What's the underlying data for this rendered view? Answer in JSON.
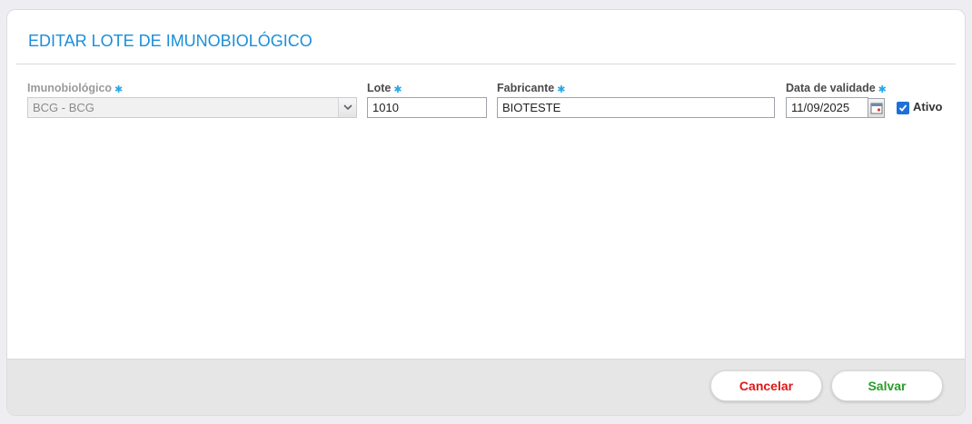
{
  "modal": {
    "title": "EDITAR LOTE DE IMUNOBIOLÓGICO"
  },
  "form": {
    "required_marker": "✱",
    "imunobiologico": {
      "label": "Imunobiológico",
      "value": "BCG - BCG",
      "disabled": true
    },
    "lote": {
      "label": "Lote",
      "value": "1010"
    },
    "fabricante": {
      "label": "Fabricante",
      "value": "BIOTESTE"
    },
    "data_validade": {
      "label": "Data de validade",
      "value": "11/09/2025"
    },
    "ativo": {
      "label": "Ativo",
      "checked": true
    }
  },
  "footer": {
    "cancel_label": "Cancelar",
    "save_label": "Salvar"
  },
  "colors": {
    "title": "#1a8fd8",
    "required": "#29a7e8",
    "cancel": "#e01818",
    "save": "#2a9d2a",
    "checkbox": "#1e6fd9"
  },
  "icons": {
    "select_arrow": "chevron-down-icon",
    "date_picker": "calendar-icon",
    "checkbox": "checkmark-icon"
  }
}
